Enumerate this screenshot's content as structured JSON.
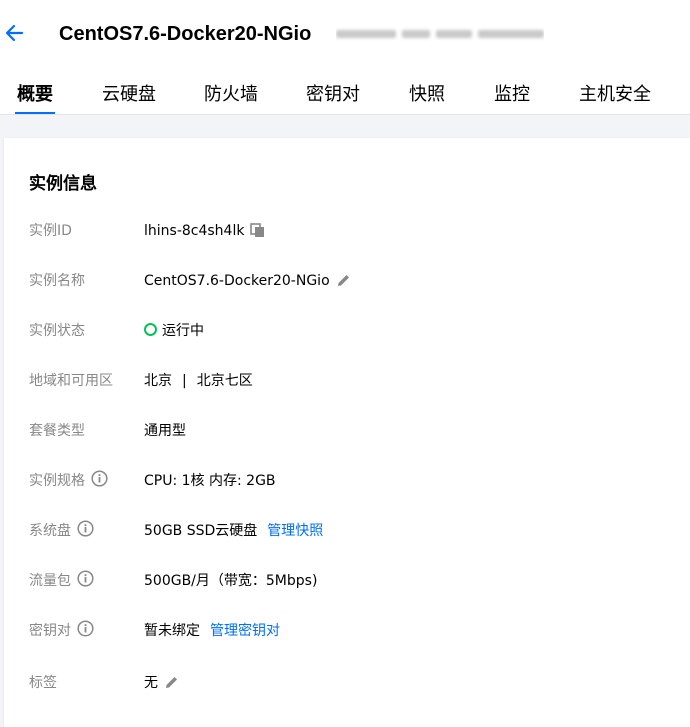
{
  "header": {
    "title": "CentOS7.6-Docker20-NGio"
  },
  "tabs": [
    {
      "label": "概要",
      "active": true
    },
    {
      "label": "云硬盘"
    },
    {
      "label": "防火墙"
    },
    {
      "label": "密钥对"
    },
    {
      "label": "快照"
    },
    {
      "label": "监控"
    },
    {
      "label": "主机安全"
    }
  ],
  "instance_info": {
    "title": "实例信息",
    "rows": {
      "id": {
        "label": "实例ID",
        "value": "lhins-8c4sh4lk"
      },
      "name": {
        "label": "实例名称",
        "value": "CentOS7.6-Docker20-NGio"
      },
      "status": {
        "label": "实例状态",
        "value": "运行中"
      },
      "region": {
        "label": "地域和可用区",
        "region": "北京",
        "separator": "|",
        "zone": "北京七区"
      },
      "bundle_type": {
        "label": "套餐类型",
        "value": "通用型"
      },
      "spec": {
        "label": "实例规格",
        "value": "CPU: 1核 内存: 2GB"
      },
      "system_disk": {
        "label": "系统盘",
        "value": "50GB SSD云硬盘",
        "link": "管理快照"
      },
      "traffic": {
        "label": "流量包",
        "value": "500GB/月（带宽：5Mbps)"
      },
      "key_pair": {
        "label": "密钥对",
        "value": "暂未绑定",
        "link": "管理密钥对"
      },
      "tags": {
        "label": "标签",
        "value": "无"
      }
    }
  },
  "colors": {
    "accent": "#006eff",
    "status_running": "#0abf5b",
    "label_gray": "#888888",
    "background": "#f3f4f7"
  }
}
